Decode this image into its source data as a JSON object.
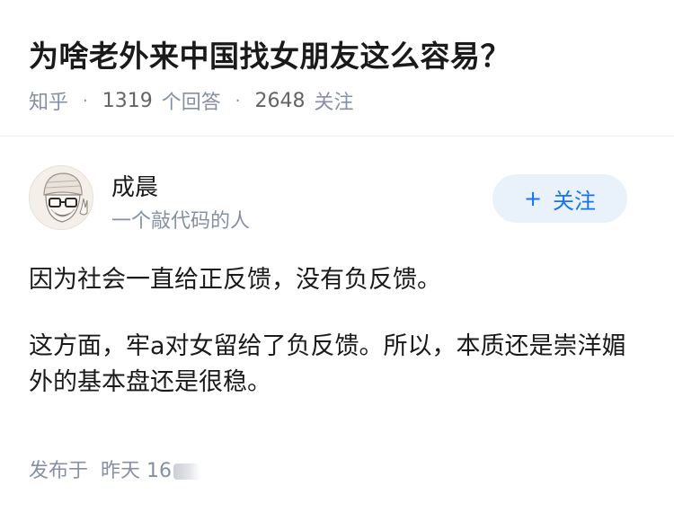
{
  "question": {
    "title": "为啥老外来中国找女朋友这么容易？",
    "source": "知乎",
    "separator": "·",
    "answers_count": "1319",
    "answers_label": "个回答",
    "followers_count": "2648",
    "followers_label": "关注"
  },
  "author": {
    "name": "成晨",
    "bio": "一个敲代码的人",
    "follow_plus": "+",
    "follow_label": "关注"
  },
  "answer": {
    "paragraphs": [
      "因为社会一直给正反馈，没有负反馈。",
      "这方面，牢a对女留给了负反馈。所以，本质还是崇洋媚外的基本盘还是很稳。"
    ]
  },
  "footer": {
    "published_label": "发布于",
    "published_time": "昨天 16"
  },
  "colors": {
    "accent": "#1772f6",
    "muted": "#8590a6",
    "follow_bg": "#e9f1fb"
  },
  "icons": {
    "avatar": "cartoon-avatar-with-glasses-and-beanie",
    "plus": "plus-icon"
  }
}
